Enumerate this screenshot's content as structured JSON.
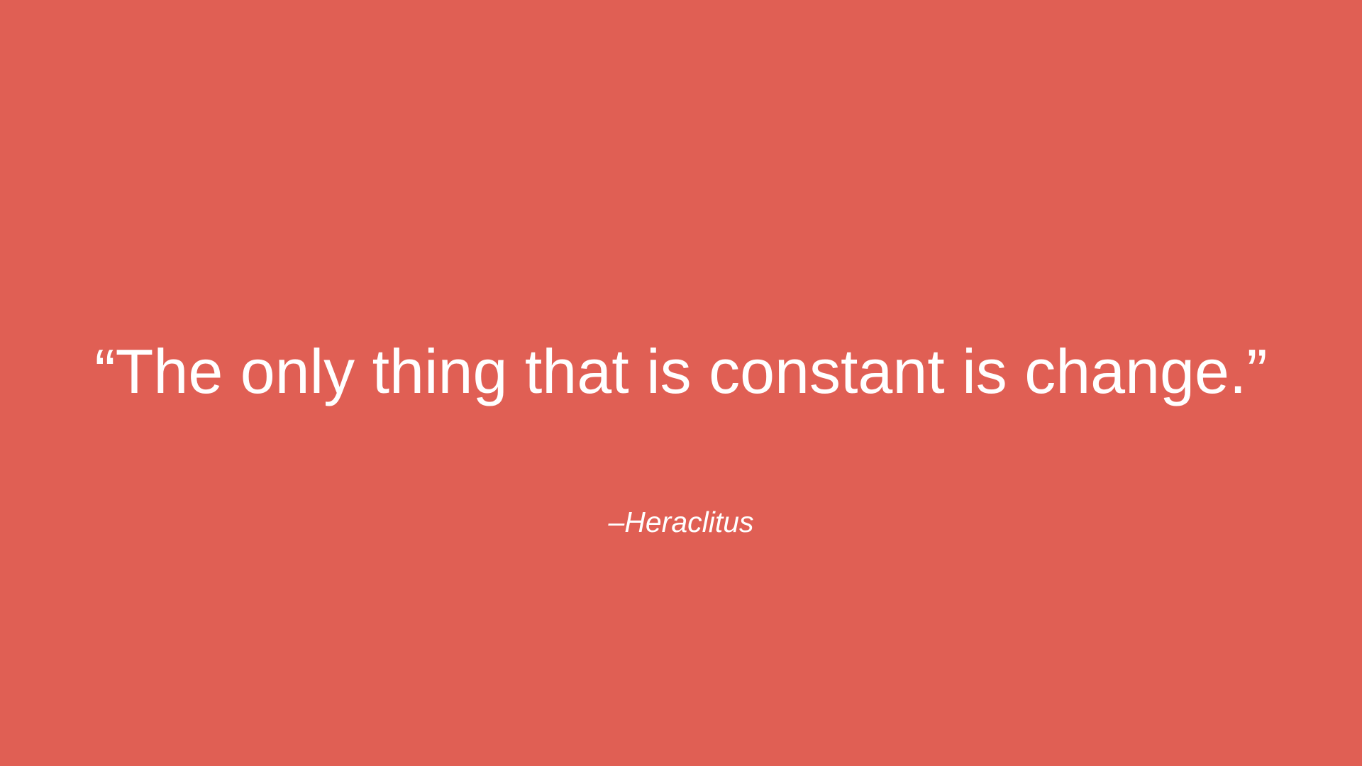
{
  "slide": {
    "quote": "“The only thing that is constant is change.”",
    "author": "–Heraclitus",
    "background_color": "#E05F54",
    "text_color": "#FFFFFF"
  }
}
